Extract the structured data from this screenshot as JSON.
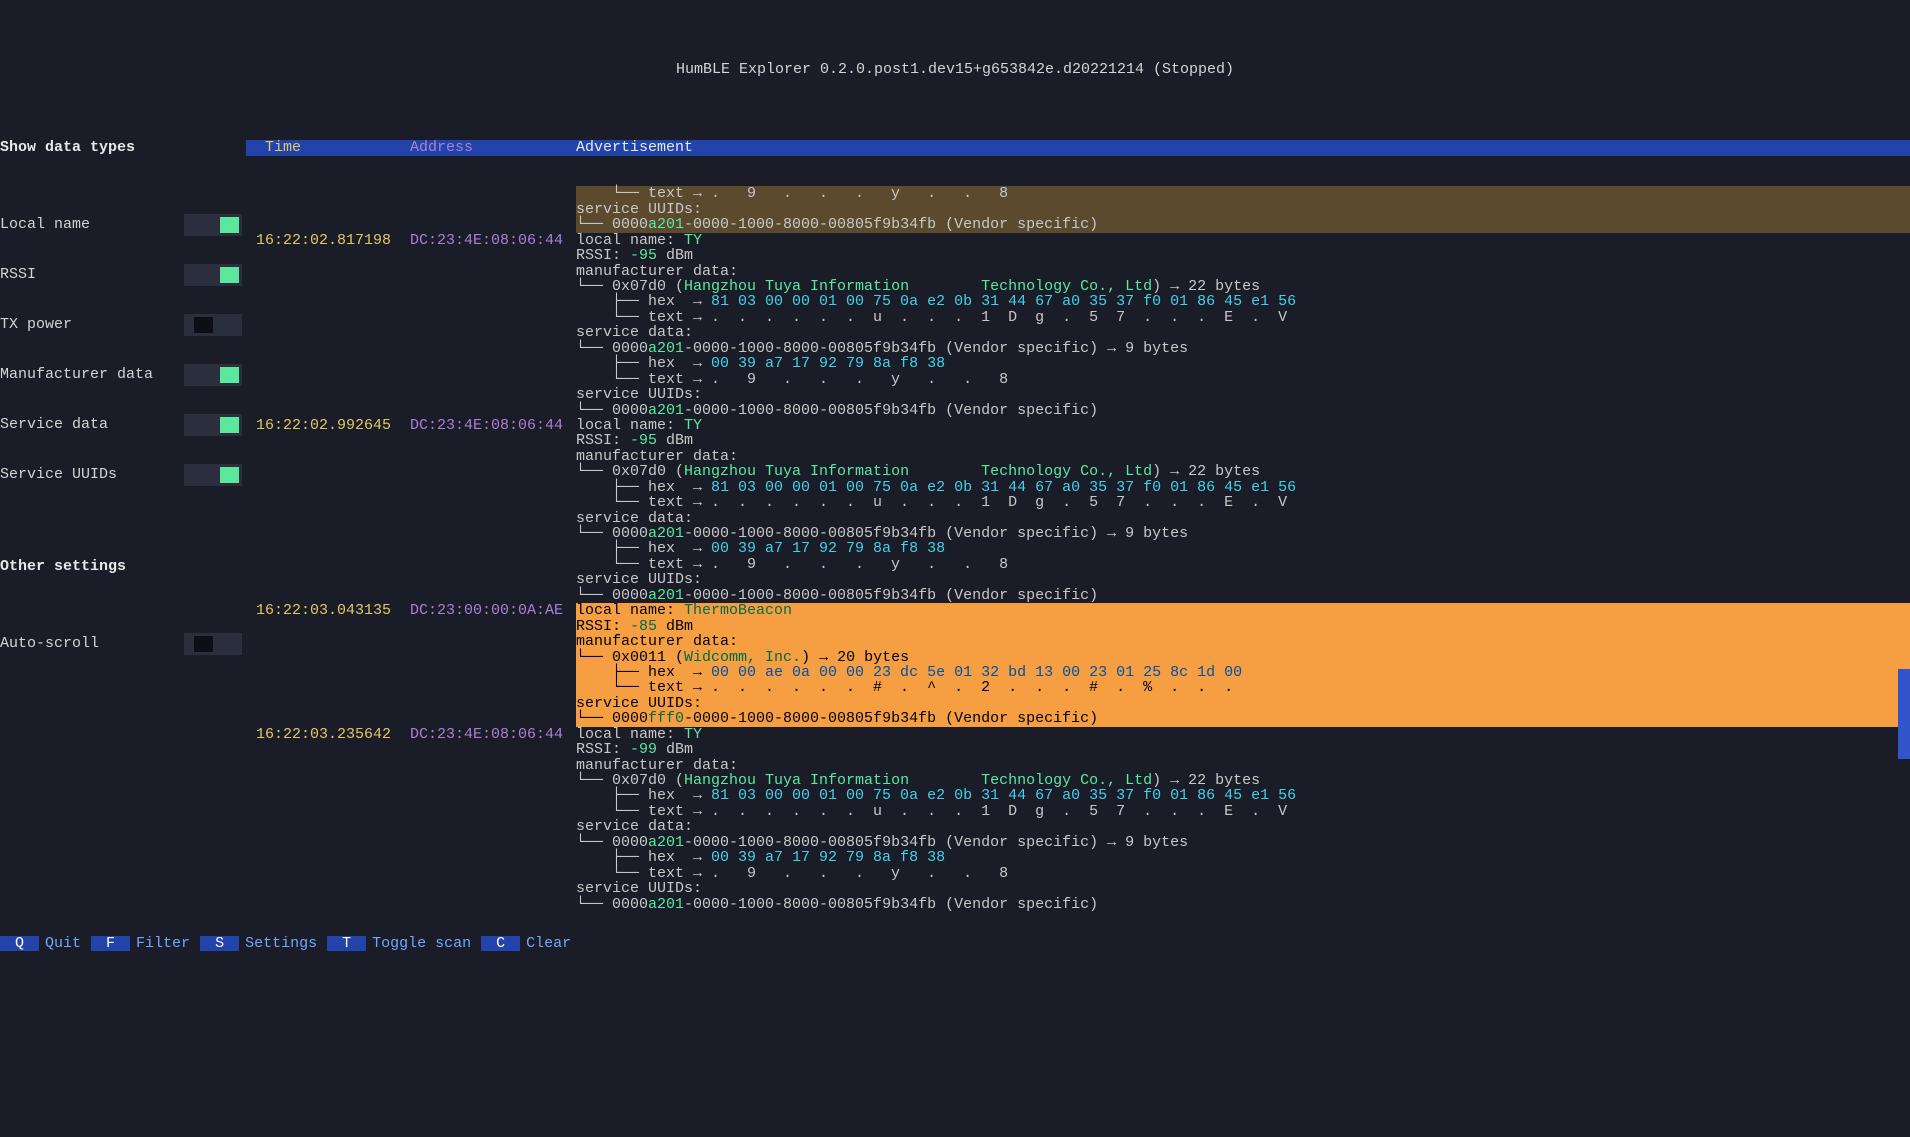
{
  "title": "HumBLE Explorer 0.2.0.post1.dev15+g653842e.d20221214 (Stopped)",
  "headers": {
    "time": " Time",
    "address": "Address",
    "advertisement": "Advertisement"
  },
  "sidebar": {
    "section1": "Show data types",
    "items": [
      {
        "label": "Local name",
        "on": true
      },
      {
        "label": "RSSI",
        "on": true
      },
      {
        "label": "TX power",
        "on": false
      },
      {
        "label": "Manufacturer data",
        "on": true
      },
      {
        "label": "Service data",
        "on": true
      },
      {
        "label": "Service UUIDs",
        "on": true
      }
    ],
    "section2": "Other settings",
    "items2": [
      {
        "label": "Auto-scroll",
        "on": false
      }
    ]
  },
  "rows": [
    {
      "time": "",
      "addr": "",
      "hover": true,
      "lines": [
        {
          "t": "tree2",
          "prefix": "    └── ",
          "label": "text → ",
          "val": ".   9   .   .   .   y   .   .   8"
        },
        {
          "t": "plain",
          "text": "service UUIDs:"
        },
        {
          "t": "uuid",
          "prefix": "└── ",
          "u1": "0000",
          "u2": "a201",
          "u3": "-0000-1000-8000-00805f9b34fb (Vendor specific)"
        }
      ]
    },
    {
      "time": "16:22:02.817198",
      "addr": "DC:23:4E:08:06:44",
      "lines": [
        {
          "t": "kv",
          "k": "local name: ",
          "v": "TY",
          "vc": "green"
        },
        {
          "t": "kv",
          "k": "RSSI: ",
          "v": "-95",
          "vc": "green",
          "suf": " dBm"
        },
        {
          "t": "plain",
          "text": "manufacturer data:"
        },
        {
          "t": "mfg",
          "prefix": "└── ",
          "id": "0x07d0 (",
          "name": "Hangzhou Tuya Information        Technology Co., Ltd",
          "suf": ") → 22 bytes"
        },
        {
          "t": "tree2",
          "prefix": "    ├── ",
          "label": "hex  → ",
          "val": "81 03 00 00 01 00 75 0a e2 0b 31 44 67 a0 35 37 f0 01 86 45 e1 56",
          "vc": "cyan"
        },
        {
          "t": "tree2",
          "prefix": "    └── ",
          "label": "text → ",
          "val": ".  .  .  .  .  .  u  .  .  .  1  D  g  .  5  7  .  .  .  E  .  V"
        },
        {
          "t": "plain",
          "text": "service data:"
        },
        {
          "t": "uuid2",
          "prefix": "└── ",
          "u1": "0000",
          "u2": "a201",
          "u3": "-0000-1000-8000-00805f9b34fb (Vendor specific) → 9 bytes"
        },
        {
          "t": "tree2",
          "prefix": "    ├── ",
          "label": "hex  → ",
          "val": "00 39 a7 17 92 79 8a f8 38",
          "vc": "cyan"
        },
        {
          "t": "tree2",
          "prefix": "    └── ",
          "label": "text → ",
          "val": ".   9   .   .   .   y   .   .   8"
        },
        {
          "t": "plain",
          "text": "service UUIDs:"
        },
        {
          "t": "uuid",
          "prefix": "└── ",
          "u1": "0000",
          "u2": "a201",
          "u3": "-0000-1000-8000-00805f9b34fb (Vendor specific)"
        }
      ]
    },
    {
      "time": "16:22:02.992645",
      "addr": "DC:23:4E:08:06:44",
      "lines": [
        {
          "t": "kv",
          "k": "local name: ",
          "v": "TY",
          "vc": "green"
        },
        {
          "t": "kv",
          "k": "RSSI: ",
          "v": "-95",
          "vc": "green",
          "suf": " dBm"
        },
        {
          "t": "plain",
          "text": "manufacturer data:"
        },
        {
          "t": "mfg",
          "prefix": "└── ",
          "id": "0x07d0 (",
          "name": "Hangzhou Tuya Information        Technology Co., Ltd",
          "suf": ") → 22 bytes"
        },
        {
          "t": "tree2",
          "prefix": "    ├── ",
          "label": "hex  → ",
          "val": "81 03 00 00 01 00 75 0a e2 0b 31 44 67 a0 35 37 f0 01 86 45 e1 56",
          "vc": "cyan"
        },
        {
          "t": "tree2",
          "prefix": "    └── ",
          "label": "text → ",
          "val": ".  .  .  .  .  .  u  .  .  .  1  D  g  .  5  7  .  .  .  E  .  V"
        },
        {
          "t": "plain",
          "text": "service data:"
        },
        {
          "t": "uuid2",
          "prefix": "└── ",
          "u1": "0000",
          "u2": "a201",
          "u3": "-0000-1000-8000-00805f9b34fb (Vendor specific) → 9 bytes"
        },
        {
          "t": "tree2",
          "prefix": "    ├── ",
          "label": "hex  → ",
          "val": "00 39 a7 17 92 79 8a f8 38",
          "vc": "cyan"
        },
        {
          "t": "tree2",
          "prefix": "    └── ",
          "label": "text → ",
          "val": ".   9   .   .   .   y   .   .   8"
        },
        {
          "t": "plain",
          "text": "service UUIDs:"
        },
        {
          "t": "uuid",
          "prefix": "└── ",
          "u1": "0000",
          "u2": "a201",
          "u3": "-0000-1000-8000-00805f9b34fb (Vendor specific)"
        }
      ]
    },
    {
      "time": "16:22:03.043135",
      "addr": "DC:23:00:00:0A:AE",
      "selected": true,
      "lines": [
        {
          "t": "kv",
          "k": "local name: ",
          "v": "ThermoBeacon",
          "vc": "green"
        },
        {
          "t": "kv",
          "k": "RSSI: ",
          "v": "-85",
          "vc": "green",
          "suf": " dBm"
        },
        {
          "t": "plain",
          "text": "manufacturer data:"
        },
        {
          "t": "mfg",
          "prefix": "└── ",
          "id": "0x0011 (",
          "name": "Widcomm, Inc.",
          "suf": ") → 20 bytes"
        },
        {
          "t": "tree2",
          "prefix": "    ├── ",
          "label": "hex  → ",
          "val": "00 00 ae 0a 00 00 23 dc 5e 01 32 bd 13 00 23 01 25 8c 1d 00",
          "vc": "cyan"
        },
        {
          "t": "tree2",
          "prefix": "    └── ",
          "label": "text → ",
          "val": ".  .  .  .  .  .  #  .  ^  .  2  .  .  .  #  .  %  .  .  ."
        },
        {
          "t": "plain",
          "text": "service UUIDs:"
        },
        {
          "t": "uuid",
          "prefix": "└── ",
          "u1": "0000",
          "u2": "fff0",
          "u3": "-0000-1000-8000-00805f9b34fb (Vendor specific)"
        }
      ]
    },
    {
      "time": "16:22:03.235642",
      "addr": "DC:23:4E:08:06:44",
      "lines": [
        {
          "t": "kv",
          "k": "local name: ",
          "v": "TY",
          "vc": "green"
        },
        {
          "t": "kv",
          "k": "RSSI: ",
          "v": "-99",
          "vc": "green",
          "suf": " dBm"
        },
        {
          "t": "plain",
          "text": "manufacturer data:"
        },
        {
          "t": "mfg",
          "prefix": "└── ",
          "id": "0x07d0 (",
          "name": "Hangzhou Tuya Information        Technology Co., Ltd",
          "suf": ") → 22 bytes"
        },
        {
          "t": "tree2",
          "prefix": "    ├── ",
          "label": "hex  → ",
          "val": "81 03 00 00 01 00 75 0a e2 0b 31 44 67 a0 35 37 f0 01 86 45 e1 56",
          "vc": "cyan"
        },
        {
          "t": "tree2",
          "prefix": "    └── ",
          "label": "text → ",
          "val": ".  .  .  .  .  .  u  .  .  .  1  D  g  .  5  7  .  .  .  E  .  V"
        },
        {
          "t": "plain",
          "text": "service data:"
        },
        {
          "t": "uuid2",
          "prefix": "└── ",
          "u1": "0000",
          "u2": "a201",
          "u3": "-0000-1000-8000-00805f9b34fb (Vendor specific) → 9 bytes"
        },
        {
          "t": "tree2",
          "prefix": "    ├── ",
          "label": "hex  → ",
          "val": "00 39 a7 17 92 79 8a f8 38",
          "vc": "cyan"
        },
        {
          "t": "tree2",
          "prefix": "    └── ",
          "label": "text → ",
          "val": ".   9   .   .   .   y   .   .   8"
        },
        {
          "t": "plain",
          "text": "service UUIDs:"
        },
        {
          "t": "uuid",
          "prefix": "└── ",
          "u1": "0000",
          "u2": "a201",
          "u3": "-0000-1000-8000-00805f9b34fb (Vendor specific)"
        }
      ]
    }
  ],
  "footer": [
    {
      "key": "Q",
      "cmd": "Quit"
    },
    {
      "key": "F",
      "cmd": "Filter"
    },
    {
      "key": "S",
      "cmd": "Settings"
    },
    {
      "key": "T",
      "cmd": "Toggle scan"
    },
    {
      "key": "C",
      "cmd": "Clear"
    }
  ]
}
